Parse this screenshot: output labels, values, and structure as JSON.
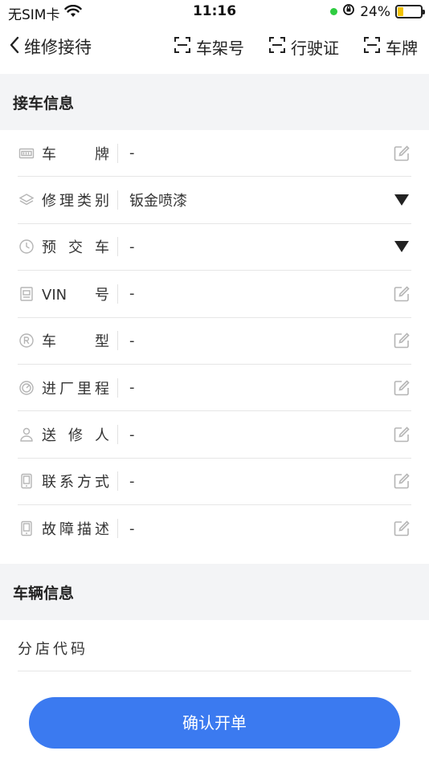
{
  "status_bar": {
    "carrier": "无SIM卡",
    "time": "11:16",
    "battery_percent": "24%",
    "battery_level": 0.24
  },
  "nav": {
    "title": "维修接待",
    "actions": [
      {
        "label": "车架号",
        "icon": "scan-icon"
      },
      {
        "label": "行驶证",
        "icon": "scan-icon"
      },
      {
        "label": "车牌",
        "icon": "scan-icon"
      }
    ]
  },
  "sections": {
    "reception": {
      "title": "接车信息"
    },
    "vehicle": {
      "title": "车辆信息"
    }
  },
  "reception_fields": [
    {
      "label": "车牌",
      "value": "-",
      "icon": "license-plate-icon",
      "trail": "edit-icon"
    },
    {
      "label": "修理类别",
      "value": "钣金喷漆",
      "icon": "layers-icon",
      "trail": "dropdown-triangle-icon"
    },
    {
      "label": "预交车",
      "value": "-",
      "icon": "clock-icon",
      "trail": "dropdown-triangle-icon"
    },
    {
      "label": "VIN号",
      "value": "-",
      "icon": "vin-icon",
      "trail": "edit-icon"
    },
    {
      "label": "车型",
      "value": "-",
      "icon": "registered-icon",
      "trail": "edit-icon"
    },
    {
      "label": "进厂里程",
      "value": "-",
      "icon": "mileage-icon",
      "trail": "edit-icon"
    },
    {
      "label": "送修人",
      "value": "-",
      "icon": "person-icon",
      "trail": "edit-icon"
    },
    {
      "label": "联系方式",
      "value": "-",
      "icon": "phone-icon",
      "trail": "edit-icon"
    },
    {
      "label": "故障描述",
      "value": "-",
      "icon": "phone-icon",
      "trail": "edit-icon"
    }
  ],
  "vehicle_fields": {
    "branch_code_label": "分店代码"
  },
  "footer": {
    "confirm_label": "确认开单"
  },
  "colors": {
    "primary": "#3b7af0",
    "section_bg": "#f3f4f6",
    "icon_gray": "#b5b5b5"
  }
}
